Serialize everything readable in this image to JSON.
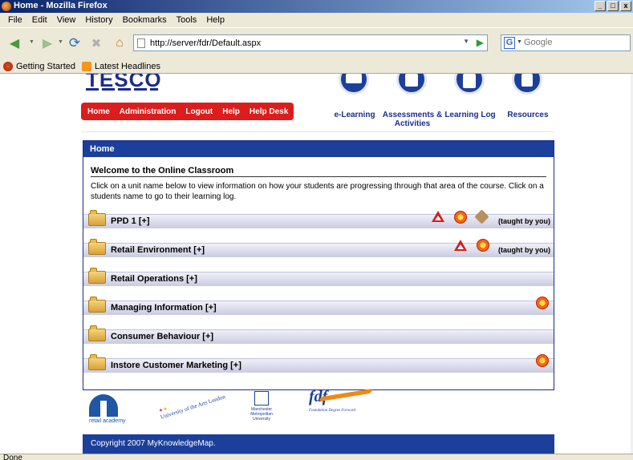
{
  "window": {
    "title": "Home - Mozilla Firefox",
    "buttons": [
      "_",
      "□",
      "x"
    ]
  },
  "menu": [
    "File",
    "Edit",
    "View",
    "History",
    "Bookmarks",
    "Tools",
    "Help"
  ],
  "nav": {
    "url": "http://server/fdr/Default.aspx",
    "search_placeholder": "Google"
  },
  "bookmarks": [
    {
      "label": "Getting Started",
      "icon": "firefox-icon"
    },
    {
      "label": "Latest Headlines",
      "icon": "rss-icon"
    }
  ],
  "site": {
    "logo_text": "TESCO",
    "menu": [
      "Home",
      "Administration",
      "Logout",
      "Help",
      "Help Desk"
    ],
    "top_icons": [
      {
        "label": "e-Learning",
        "icon": "envelope-icon"
      },
      {
        "label": "Assessments & Activities",
        "icon": "document-icon"
      },
      {
        "label": "Learning Log",
        "icon": "notepad-icon"
      },
      {
        "label": "Resources",
        "icon": "book-icon"
      }
    ],
    "panel_title": "Home",
    "welcome": "Welcome to the Online Classroom",
    "intro": "Click on a unit name below to view information on how your students are progressing through that area of the course. Click on a students name to go to their learning log.",
    "units": [
      {
        "label": "PPD 1 [+]",
        "icons": [
          "warning-icon",
          "burst-icon",
          "tag-icon"
        ],
        "note": "(taught by you)"
      },
      {
        "label": "Retail Environment [+]",
        "icons": [
          "warning-icon",
          "burst-icon"
        ],
        "note": "(taught by you)"
      },
      {
        "label": "Retail Operations [+]",
        "icons": [],
        "note": ""
      },
      {
        "label": "Managing Information [+]",
        "icons": [
          "burst-icon"
        ],
        "note": ""
      },
      {
        "label": "Consumer Behaviour [+]",
        "icons": [],
        "note": ""
      },
      {
        "label": "Instore Customer Marketing [+]",
        "icons": [
          "burst-icon"
        ],
        "note": ""
      }
    ],
    "logos": {
      "retail_academy": "retail academy",
      "arts_london": "University of the Arts London",
      "mmu": "Manchester Metropolitan University",
      "fdf": "fdf",
      "fdf_sub": "Foundation Degree Forward"
    },
    "footer": "Copyright 2007 MyKnowledgeMap."
  },
  "status": "Done"
}
